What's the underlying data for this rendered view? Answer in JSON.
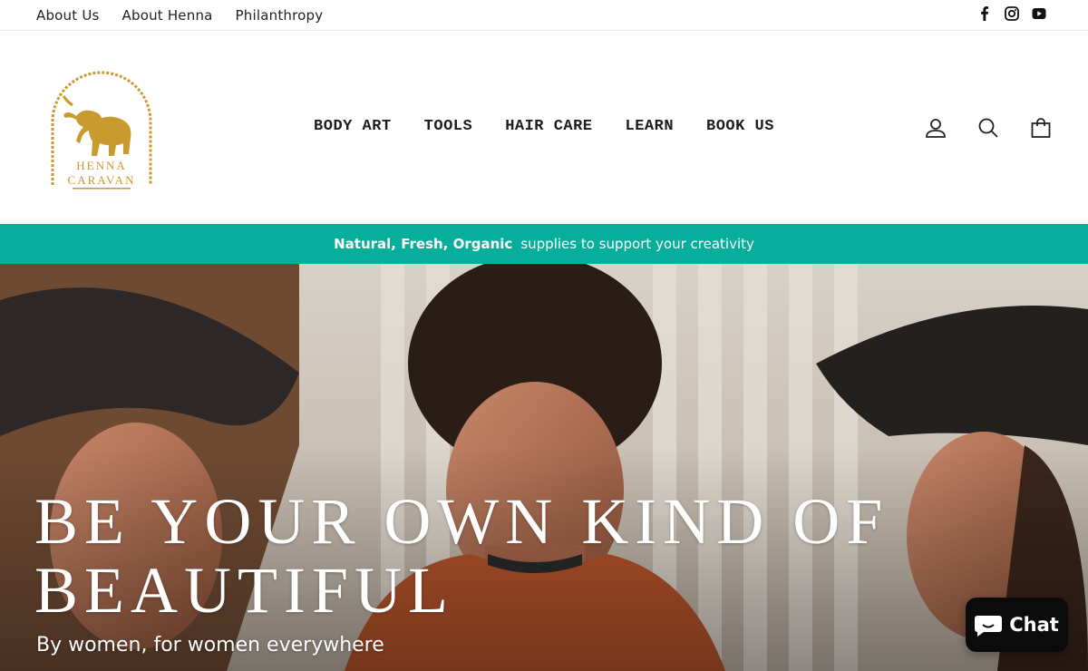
{
  "utility": {
    "links": [
      "About Us",
      "About Henna",
      "Philanthropy"
    ],
    "social_icons": [
      "facebook-icon",
      "instagram-icon",
      "youtube-icon"
    ]
  },
  "logo": {
    "line1": "HENNA",
    "line2": "CARAVAN",
    "color": "#c99a2e"
  },
  "nav": {
    "items": [
      "BODY ART",
      "TOOLS",
      "HAIR CARE",
      "LEARN",
      "BOOK US"
    ]
  },
  "header_icons": [
    "account-icon",
    "search-icon",
    "cart-icon"
  ],
  "announcement": {
    "bold": "Natural, Fresh, Organic",
    "text": "supplies to support your creativity",
    "background": "#07ae9c"
  },
  "hero": {
    "title": "BE YOUR OWN KIND OF BEAUTIFUL",
    "subtitle": "By women, for women everywhere"
  },
  "chat": {
    "label": "Chat",
    "background": "#0b0b0b"
  }
}
